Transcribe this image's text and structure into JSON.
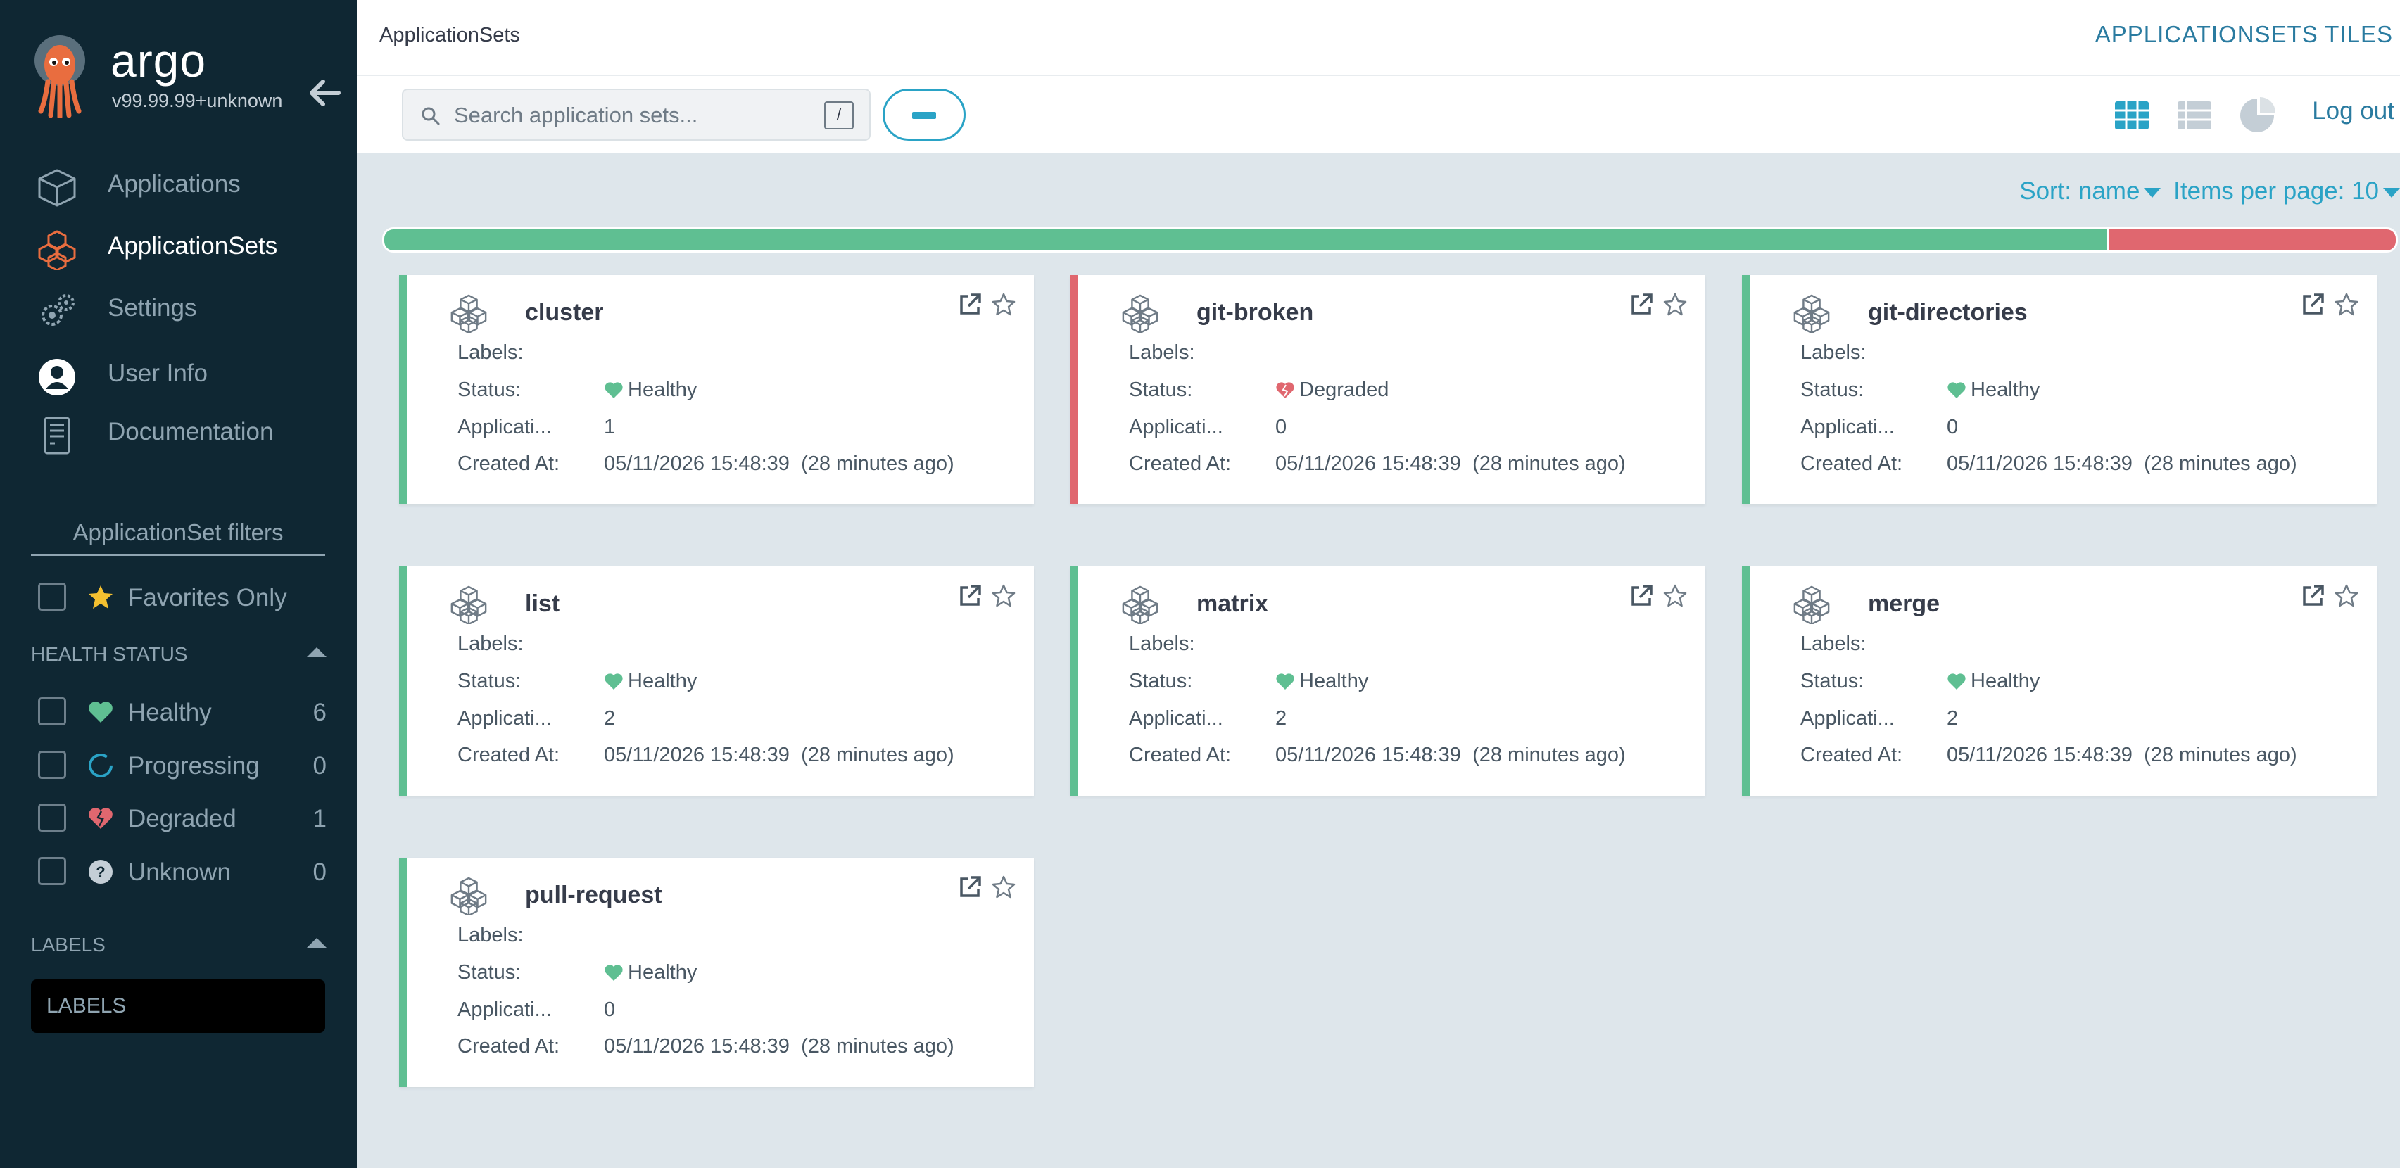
{
  "brand": {
    "name": "argo",
    "version": "v99.99.99+unknown"
  },
  "nav": [
    {
      "label": "Applications",
      "icon": "cube-icon"
    },
    {
      "label": "ApplicationSets",
      "icon": "cubes-icon",
      "active": true
    },
    {
      "label": "Settings",
      "icon": "gears-icon"
    },
    {
      "label": "User Info",
      "icon": "user-circle-icon"
    },
    {
      "label": "Documentation",
      "icon": "book-icon"
    }
  ],
  "filters": {
    "title": "ApplicationSet filters",
    "favorites_label": "Favorites Only",
    "health_title": "HEALTH STATUS",
    "health": [
      {
        "label": "Healthy",
        "count": "6",
        "color": "#5fbf92"
      },
      {
        "label": "Progressing",
        "count": "0",
        "color": "#2aa3c6"
      },
      {
        "label": "Degraded",
        "count": "1",
        "color": "#e0676f"
      },
      {
        "label": "Unknown",
        "count": "0",
        "color": "#ffffff"
      }
    ],
    "labels_title": "LABELS",
    "labels_placeholder": "LABELS"
  },
  "header": {
    "breadcrumb": "ApplicationSets",
    "title": "APPLICATIONSETS TILES"
  },
  "toolbar": {
    "search_placeholder": "Search application sets...",
    "search_shortcut": "/",
    "logout": "Log out"
  },
  "sort": {
    "sort_label": "Sort: name",
    "per_page_label": "Items per page: 10"
  },
  "health_summary": {
    "healthy": 6,
    "degraded": 1,
    "healthy_color": "#5fbf92",
    "degraded_color": "#e0676f"
  },
  "field_labels": {
    "labels": "Labels:",
    "status": "Status:",
    "applications": "Applicati...",
    "created": "Created At:"
  },
  "tiles": [
    {
      "name": "cluster",
      "status": "Healthy",
      "apps": "1",
      "created": "05/11/2026 15:48:39",
      "ago": "(28 minutes ago)"
    },
    {
      "name": "git-broken",
      "status": "Degraded",
      "apps": "0",
      "created": "05/11/2026 15:48:39",
      "ago": "(28 minutes ago)"
    },
    {
      "name": "git-directories",
      "status": "Healthy",
      "apps": "0",
      "created": "05/11/2026 15:48:39",
      "ago": "(28 minutes ago)"
    },
    {
      "name": "list",
      "status": "Healthy",
      "apps": "2",
      "created": "05/11/2026 15:48:39",
      "ago": "(28 minutes ago)"
    },
    {
      "name": "matrix",
      "status": "Healthy",
      "apps": "2",
      "created": "05/11/2026 15:48:39",
      "ago": "(28 minutes ago)"
    },
    {
      "name": "merge",
      "status": "Healthy",
      "apps": "2",
      "created": "05/11/2026 15:48:39",
      "ago": "(28 minutes ago)"
    },
    {
      "name": "pull-request",
      "status": "Healthy",
      "apps": "0",
      "created": "05/11/2026 15:48:39",
      "ago": "(28 minutes ago)"
    }
  ]
}
